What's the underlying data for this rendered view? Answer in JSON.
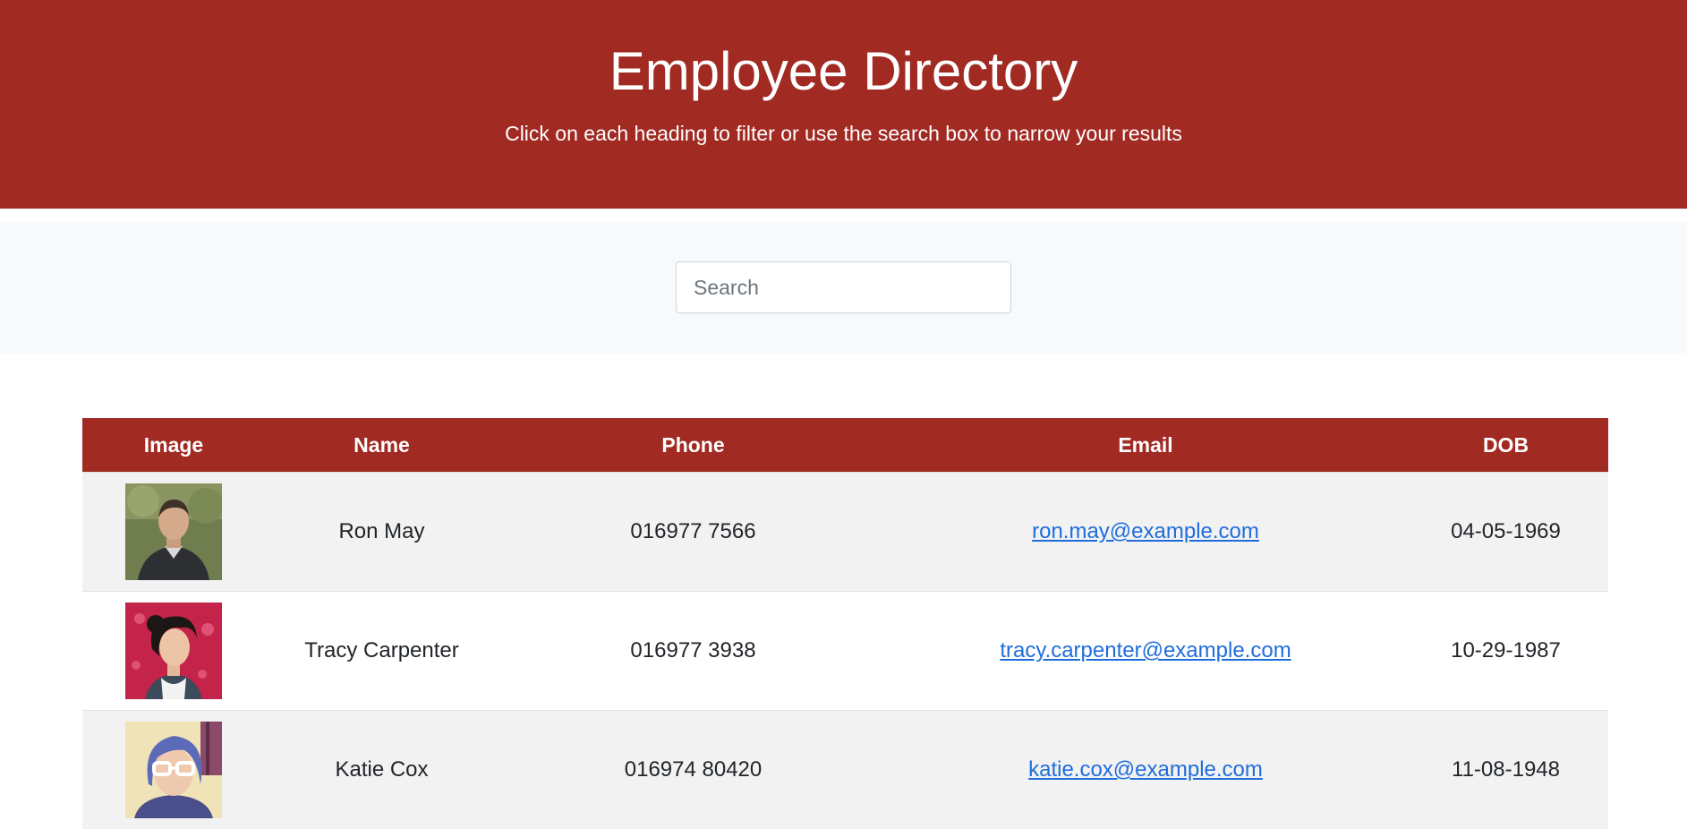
{
  "header": {
    "title": "Employee Directory",
    "subtitle": "Click on each heading to filter or use the search box to narrow your results"
  },
  "search": {
    "placeholder": "Search",
    "value": ""
  },
  "table": {
    "columns": [
      "Image",
      "Name",
      "Phone",
      "Email",
      "DOB"
    ],
    "rows": [
      {
        "name": "Ron May",
        "phone": "016977 7566",
        "email": "ron.may@example.com",
        "dob": "04-05-1969"
      },
      {
        "name": "Tracy Carpenter",
        "phone": "016977 3938",
        "email": "tracy.carpenter@example.com",
        "dob": "10-29-1987"
      },
      {
        "name": "Katie Cox",
        "phone": "016974 80420",
        "email": "katie.cox@example.com",
        "dob": "11-08-1948"
      }
    ]
  },
  "colors": {
    "brand": "#a12a23",
    "link": "#1f6ddb",
    "row_stripe": "#f2f2f2"
  }
}
